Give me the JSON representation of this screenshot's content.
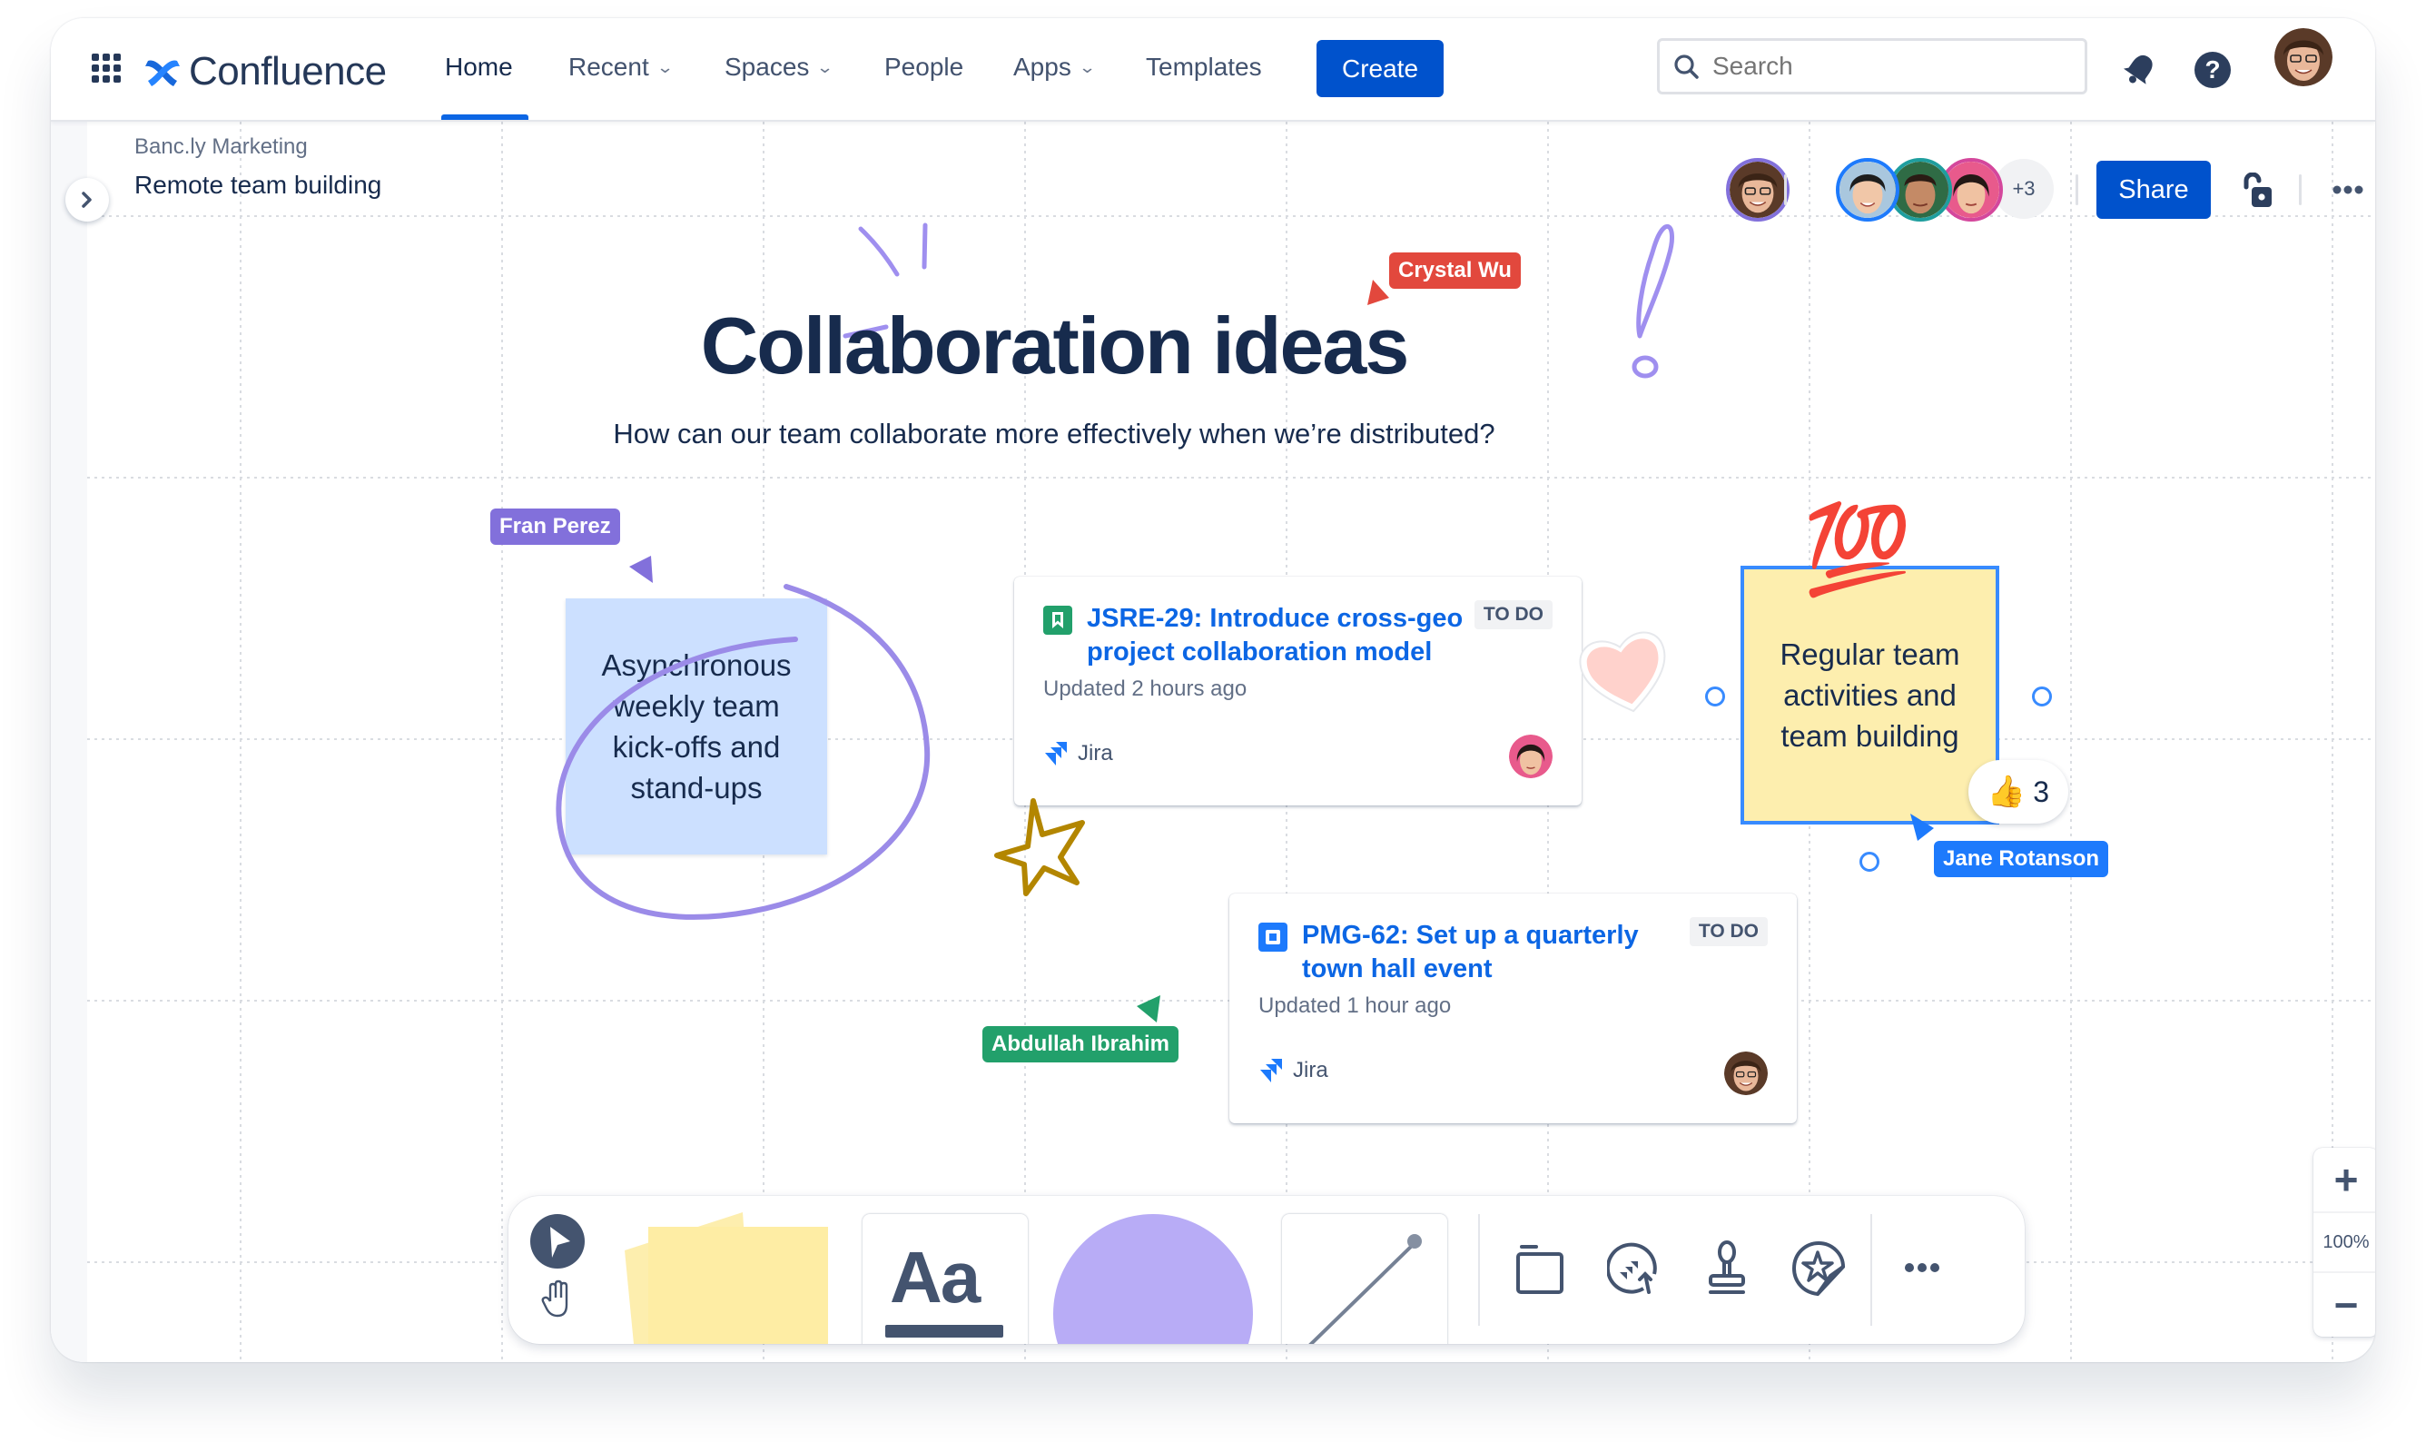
{
  "header": {
    "app_name": "Confluence",
    "nav": [
      {
        "label": "Home",
        "active": true,
        "has_menu": false
      },
      {
        "label": "Recent",
        "active": false,
        "has_menu": true
      },
      {
        "label": "Spaces",
        "active": false,
        "has_menu": true
      },
      {
        "label": "People",
        "active": false,
        "has_menu": false
      },
      {
        "label": "Apps",
        "active": false,
        "has_menu": true
      },
      {
        "label": "Templates",
        "active": false,
        "has_menu": false
      }
    ],
    "create_label": "Create",
    "search_placeholder": "Search",
    "icons": {
      "app_switcher": "grid-icon",
      "notifications": "bell-icon",
      "help": "help-icon",
      "profile": "user-avatar"
    }
  },
  "page": {
    "space": "Banc.ly Marketing",
    "title": "Remote team building",
    "collaborators_extra": "+3",
    "share_label": "Share",
    "icons": {
      "expand": "chevron-right-icon",
      "lock": "unlock-icon",
      "more": "more-icon"
    }
  },
  "board": {
    "title": "Collaboration ideas",
    "subtitle": "How can our team collaborate more effectively when we’re distributed?",
    "cursors": [
      {
        "name": "Crystal Wu",
        "color": "#e2483d"
      },
      {
        "name": "Fran Perez",
        "color": "#8270db"
      },
      {
        "name": "Jane Rotanson",
        "color": "#1d7afc"
      },
      {
        "name": "Abdullah Ibrahim",
        "color": "#22a06b"
      }
    ],
    "stickies": [
      {
        "text": "Asynchronous weekly team kick-offs and stand-ups",
        "color": "#cce0ff"
      },
      {
        "text": "Regular team activities and team building",
        "color": "#fdeeae"
      }
    ],
    "reaction": {
      "emoji": "👍",
      "count": "3"
    },
    "sticker_100": "💯",
    "cards": [
      {
        "key_title": "JSRE-29: Introduce cross-geo project collaboration model",
        "status": "TO DO",
        "updated": "Updated 2 hours ago",
        "source": "Jira",
        "issue_type": "story-icon"
      },
      {
        "key_title": "PMG-62: Set up a quarterly town hall event",
        "status": "TO DO",
        "updated": "Updated 1 hour ago",
        "source": "Jira",
        "issue_type": "task-icon"
      }
    ]
  },
  "toolbar": {
    "tools": [
      "select-tool",
      "hand-tool",
      "sticky-note-tool",
      "text-tool",
      "shape-tool",
      "line-tool",
      "frame-tool",
      "jira-sync-tool",
      "stamp-tool",
      "sticker-tool",
      "more-tools"
    ],
    "text_tool_label": "Aa"
  },
  "zoom": {
    "level": "100%",
    "zoom_in": "+",
    "zoom_out": "−"
  }
}
